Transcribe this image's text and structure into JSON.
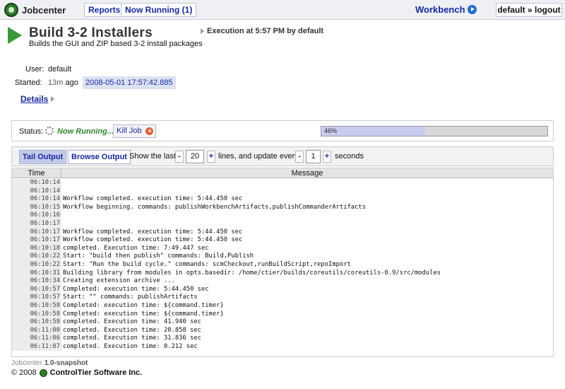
{
  "topbar": {
    "brand": "Jobcenter",
    "reports": "Reports",
    "now_running": "Now Running (1)",
    "workbench": "Workbench",
    "logout": "default » logout"
  },
  "header": {
    "title": "Build 3-2 Installers",
    "description": "Builds the GUI and ZIP based 3-2 install packages",
    "execution": "Execution at 5:57 PM by default"
  },
  "info": {
    "user_label": "User:",
    "user_value": "default",
    "started_label": "Started:",
    "started_ago_num": "13m",
    "started_ago_word": "ago",
    "started_date": "2008-05-01 17:57:42.885",
    "details_link": "Details"
  },
  "status": {
    "label": "Status:",
    "running": "Now Running...",
    "kill_job": "Kill Job",
    "progress_percent": 46,
    "progress_text": "46%"
  },
  "output_toolbar": {
    "tail": "Tail Output",
    "browse": "Browse Output",
    "show_last": "Show the last",
    "lines_value": "20",
    "lines_update": "lines, and update every",
    "seconds_value": "1",
    "seconds": "seconds",
    "minus": "-",
    "plus": "+"
  },
  "log": {
    "col_time": "Time",
    "col_message": "Message",
    "rows": [
      {
        "time": "06:10:14",
        "msg": ""
      },
      {
        "time": "06:10:14",
        "msg": ""
      },
      {
        "time": "06:10:14",
        "msg": "Workflow completed. execution time: 5:44.450 sec"
      },
      {
        "time": "06:10:15",
        "msg": "Workflow beginning. commands: publishWorkbenchArtifacts,publishCommanderArtifacts"
      },
      {
        "time": "06:10:16",
        "msg": ""
      },
      {
        "time": "06:10:17",
        "msg": ""
      },
      {
        "time": "06:10:17",
        "msg": "Workflow completed. execution time: 5:44.450 sec"
      },
      {
        "time": "06:10:17",
        "msg": "Workflow completed. execution time: 5:44.450 sec"
      },
      {
        "time": "06:10:18",
        "msg": "completed. Execution time: 7:49.447 sec"
      },
      {
        "time": "06:10:22",
        "msg": "Start: \"build then publish\" commands: Build,Publish"
      },
      {
        "time": "06:10:22",
        "msg": "Start: \"Run the build cycle.\" commands: scmCheckout,runBuildScript,repoImport"
      },
      {
        "time": "06:10:31",
        "msg": "Building library from modules in opts.basedir: /home/ctier/builds/coreutils/coreutils-0.9/src/modules"
      },
      {
        "time": "06:10:34",
        "msg": "Creating extension archive ..."
      },
      {
        "time": "06:10:57",
        "msg": "Completed: execution time: 5:44.450 sec"
      },
      {
        "time": "06:10:57",
        "msg": "Start: \"\" commands: publishArtifacts"
      },
      {
        "time": "06:10:58",
        "msg": "Completed: execution time: ${command.timer}"
      },
      {
        "time": "06:10:58",
        "msg": "Completed: execution time: ${command.timer}"
      },
      {
        "time": "06:10:58",
        "msg": "completed. Execution time: 41.940 sec"
      },
      {
        "time": "06:11:00",
        "msg": "completed. Execution time: 20.858 sec"
      },
      {
        "time": "06:11:06",
        "msg": "completed. Execution time: 31.836 sec"
      },
      {
        "time": "06:11:07",
        "msg": "completed. Execution time: 0.212 sec"
      }
    ]
  },
  "footer": {
    "app": "Jobcenter",
    "version": "1.0-snapshot",
    "copyright": "© 2008",
    "company": "ControlTier Software Inc."
  },
  "icons": {
    "brand": "jobcenter-logo-icon",
    "workbench_arrow": "arrow-right-circle-icon",
    "play": "play-icon",
    "kill": "close-icon",
    "spinner": "spinner-icon"
  },
  "colors": {
    "link": "#1428a8",
    "running": "#2a8a2a",
    "progress_fill": "#c8ccf0"
  }
}
